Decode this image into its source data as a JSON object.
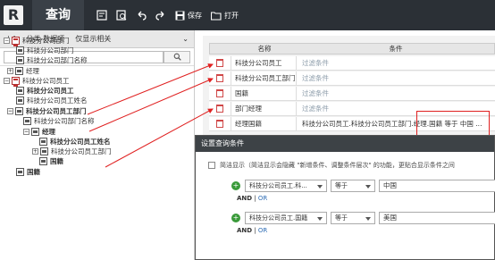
{
  "toolbar": {
    "logo": "R",
    "title": "查询",
    "save_label": "保存",
    "open_label": "打开"
  },
  "left_panel": {
    "tab_category": "分类-数据项",
    "tab_filter": "仅显示相关",
    "tree": [
      {
        "label": "科技分公司部门",
        "bold": false
      },
      {
        "label": "科技分公司部门",
        "bold": false
      },
      {
        "label": "科技分公司部门名称",
        "bold": false
      },
      {
        "label": "经理",
        "bold": false
      },
      {
        "label": "科技分公司员工",
        "bold": false
      },
      {
        "label": "科技分公司员工",
        "bold": true
      },
      {
        "label": "科技分公司员工姓名",
        "bold": false
      },
      {
        "label": "科技分公司员工部门",
        "bold": true
      },
      {
        "label": "科技分公司部门名称",
        "bold": false
      },
      {
        "label": "经理",
        "bold": true
      },
      {
        "label": "科技分公司员工姓名",
        "bold": true
      },
      {
        "label": "科技分公司员工部门",
        "bold": false
      },
      {
        "label": "国籍",
        "bold": true
      },
      {
        "label": "国籍",
        "bold": true
      }
    ]
  },
  "grid": {
    "header_name": "名称",
    "header_condition": "条件",
    "rows": [
      {
        "name": "科技分公司员工",
        "condition": "过滤条件",
        "muted": true
      },
      {
        "name": "科技分公司员工部门",
        "condition": "过滤条件",
        "muted": true
      },
      {
        "name": "国籍",
        "condition": "过滤条件",
        "muted": true
      },
      {
        "name": "部门经理",
        "condition": "过滤条件",
        "muted": true
      },
      {
        "name": "经理国籍",
        "condition": "科技分公司员工.科技分公司员工部门.经理.国籍 等于 中国 ...",
        "muted": false
      }
    ]
  },
  "dialog": {
    "title": "设置查询条件",
    "option_text": "简洁显示（简洁显示会隐藏 \"新增条件、调整条件层次\" 的功能，更贴合显示条件之间",
    "conditions": [
      {
        "field": "科技分公司员工.科...",
        "operator": "等于",
        "value": "中国"
      },
      {
        "field": "科技分公司员工.国籍",
        "operator": "等于",
        "value": "美国"
      }
    ],
    "and_label": "AND",
    "sep": " | ",
    "or_label": "OR"
  },
  "colors": {
    "topbar": "#2b3036",
    "accent_red": "#e02020",
    "link_blue": "#2f6db5"
  }
}
